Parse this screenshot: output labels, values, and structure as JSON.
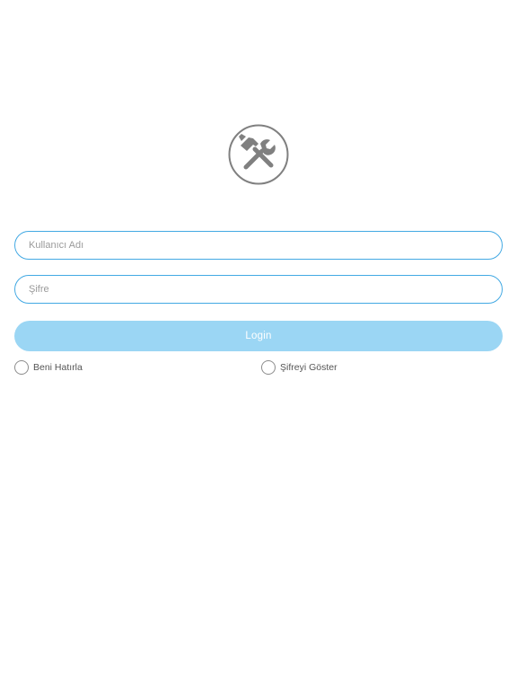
{
  "logo": {
    "icon": "hammer-wrench-icon",
    "color": "#808080"
  },
  "form": {
    "username_placeholder": "Kullanıcı Adı",
    "password_placeholder": "Şifre",
    "login_label": "Login",
    "remember_label": "Beni Hatırla",
    "show_password_label": "Şifreyi Göster"
  },
  "colors": {
    "accent": "#43a9e3",
    "button": "#9bd6f4"
  }
}
